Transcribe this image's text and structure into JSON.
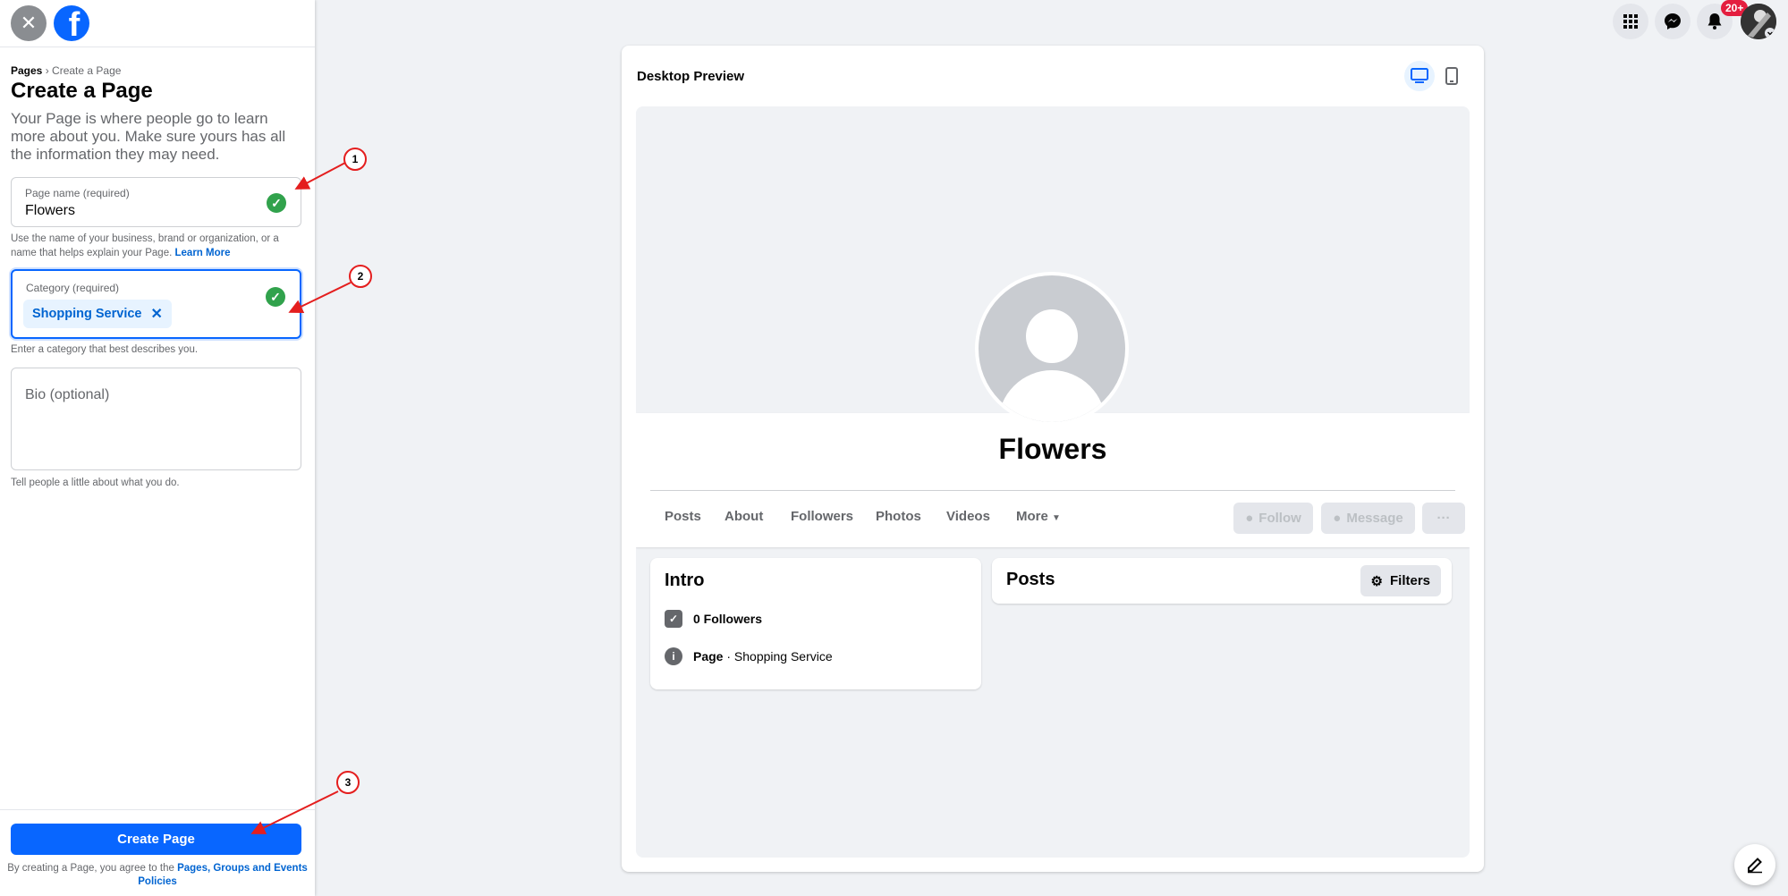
{
  "sidebar": {
    "breadcrumb_root": "Pages",
    "breadcrumb_sep": " › ",
    "breadcrumb_current": "Create a Page",
    "title": "Create a Page",
    "description": "Your Page is where people go to learn more about you. Make sure yours has all the information they may need.",
    "page_name": {
      "label": "Page name (required)",
      "value": "Flowers",
      "help": "Use the name of your business, brand or organization, or a name that helps explain your Page.",
      "help_link": "Learn More"
    },
    "category": {
      "label": "Category (required)",
      "chip": "Shopping Service",
      "help": "Enter a category that best describes you."
    },
    "bio": {
      "placeholder": "Bio (optional)",
      "help": "Tell people a little about what you do."
    },
    "create_button": "Create Page",
    "agree_text": "By creating a Page, you agree to the",
    "agree_link": "Pages, Groups and Events Policies"
  },
  "annotations": [
    "1",
    "2",
    "3"
  ],
  "preview": {
    "title": "Desktop Preview",
    "page_name": "Flowers",
    "tabs": [
      "Posts",
      "About",
      "Followers",
      "Photos",
      "Videos",
      "More"
    ],
    "follow_button": "Follow",
    "message_button": "Message",
    "more_button": "···",
    "intro": {
      "title": "Intro",
      "followers": "0 Followers",
      "page_label": "Page",
      "page_category": " · Shopping Service"
    },
    "posts": {
      "title": "Posts",
      "filters_button": "Filters"
    }
  },
  "topbar": {
    "notification_badge": "20+"
  },
  "colors": {
    "brand": "#0866ff",
    "check": "#31a24c",
    "annotation": "#e41e1e",
    "badge": "#e41e3f"
  }
}
